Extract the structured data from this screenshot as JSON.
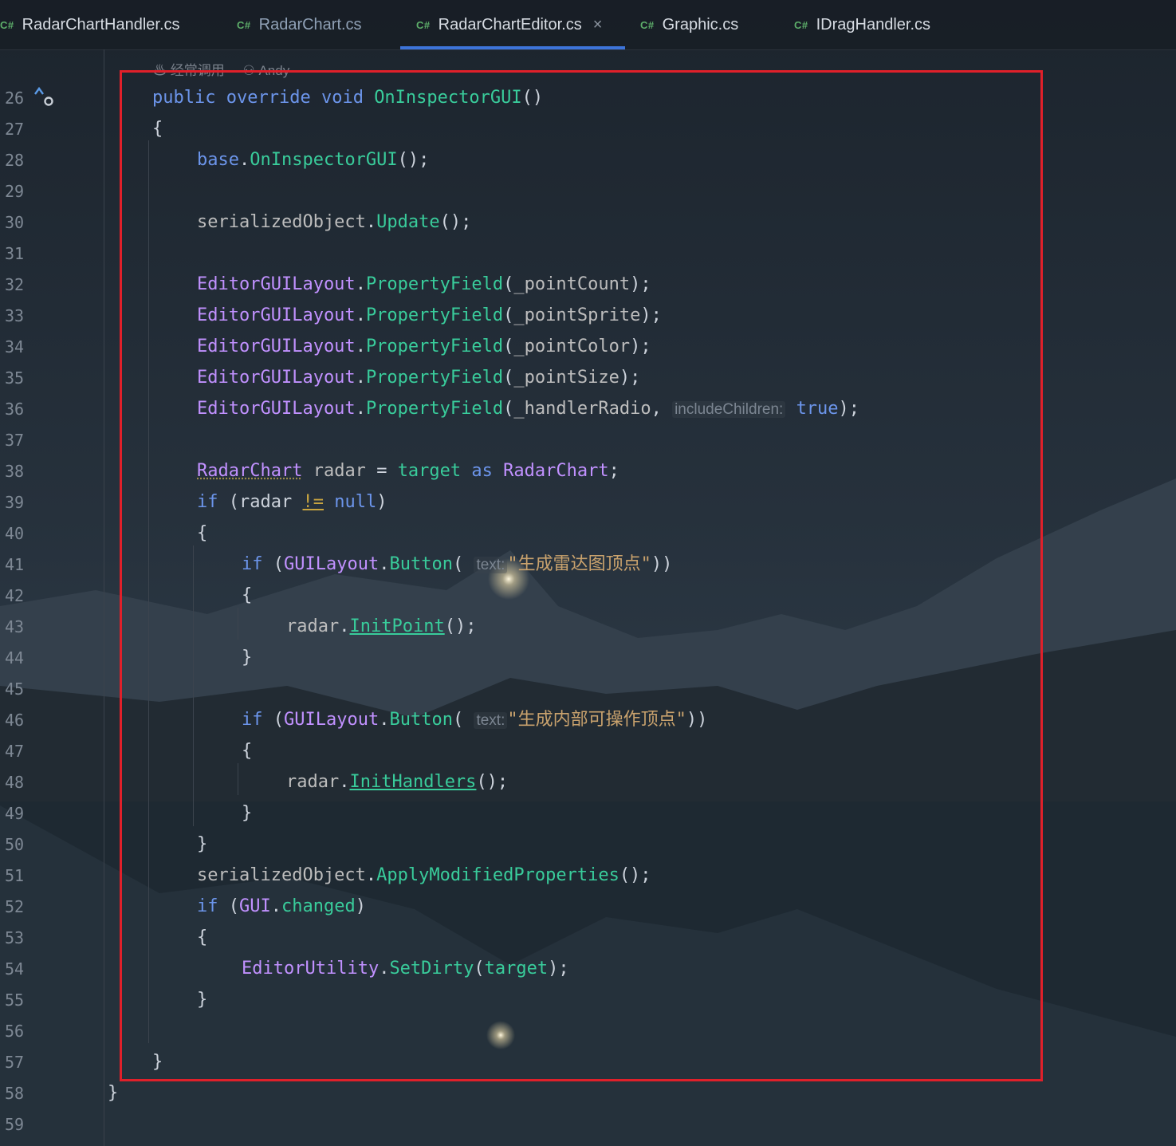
{
  "tabs": [
    {
      "lang": "C#",
      "label": "RadarChartHandler.cs",
      "active": false
    },
    {
      "lang": "C#",
      "label": "RadarChart.cs",
      "active": false
    },
    {
      "lang": "C#",
      "label": "RadarChartEditor.cs",
      "active": true
    },
    {
      "lang": "C#",
      "label": "Graphic.cs",
      "active": false
    },
    {
      "lang": "C#",
      "label": "IDragHandler.cs",
      "active": false
    }
  ],
  "close_glyph": "×",
  "codelens": {
    "usage": "经常调用",
    "author": "Andy"
  },
  "line_numbers": [
    "26",
    "27",
    "28",
    "29",
    "30",
    "31",
    "32",
    "33",
    "34",
    "35",
    "36",
    "37",
    "38",
    "39",
    "40",
    "41",
    "42",
    "43",
    "44",
    "45",
    "46",
    "47",
    "48",
    "49",
    "50",
    "51",
    "52",
    "53",
    "54",
    "55",
    "56",
    "57",
    "58",
    "59"
  ],
  "code": {
    "l26": {
      "public": "public",
      "override": "override",
      "void": "void",
      "name": "OnInspectorGUI",
      "rest": "()"
    },
    "l27": "{",
    "l28": {
      "base": "base",
      "dot": ".",
      "method": "OnInspectorGUI",
      "rest": "();"
    },
    "l30": {
      "obj": "serializedObject",
      "dot": ".",
      "method": "Update",
      "rest": "();"
    },
    "props": [
      {
        "cls": "EditorGUILayout",
        "method": "PropertyField",
        "arg": "_pointCount",
        "end": ");"
      },
      {
        "cls": "EditorGUILayout",
        "method": "PropertyField",
        "arg": "_pointSprite",
        "end": ");"
      },
      {
        "cls": "EditorGUILayout",
        "method": "PropertyField",
        "arg": "_pointColor",
        "end": ");"
      },
      {
        "cls": "EditorGUILayout",
        "method": "PropertyField",
        "arg": "_pointSize",
        "end": ");"
      }
    ],
    "l36": {
      "cls": "EditorGUILayout",
      "method": "PropertyField",
      "arg": "_handlerRadio",
      "comma": ",",
      "hint": "includeChildren:",
      "val": "true",
      "end": ");"
    },
    "l38": {
      "type": "RadarChart",
      "var": "radar",
      "eq": "=",
      "target": "target",
      "as": "as",
      "type2": "RadarChart",
      "end": ";"
    },
    "l39": {
      "if": "if",
      "open": "(radar",
      "op": "!=",
      "null": "null",
      "close": ")"
    },
    "l40": "{",
    "l41": {
      "if": "if",
      "open": "(",
      "cls": "GUILayout",
      "method": "Button",
      "paren": "(",
      "hint": "text:",
      "str": "\"生成雷达图顶点\"",
      "close": "))"
    },
    "l42": "{",
    "l43": {
      "obj": "radar",
      "method": "InitPoint",
      "rest": "();"
    },
    "l44": "}",
    "l46": {
      "if": "if",
      "open": "(",
      "cls": "GUILayout",
      "method": "Button",
      "paren": "(",
      "hint": "text:",
      "str": "\"生成内部可操作顶点\"",
      "close": "))"
    },
    "l47": "{",
    "l48": {
      "obj": "radar",
      "method": "InitHandlers",
      "rest": "();"
    },
    "l49": "}",
    "l50": "}",
    "l51": {
      "obj": "serializedObject",
      "method": "ApplyModifiedProperties",
      "rest": "();"
    },
    "l52": {
      "if": "if",
      "open": "(",
      "cls": "GUI",
      "prop": "changed",
      "close": ")"
    },
    "l53": "{",
    "l54": {
      "cls": "EditorUtility",
      "method": "SetDirty",
      "open": "(",
      "arg": "target",
      "end": ");"
    },
    "l55": "}",
    "l57": "}",
    "l58": "}"
  },
  "colors": {
    "highlight_box": "#e0202a",
    "active_tab_underline": "#3d74d9"
  }
}
